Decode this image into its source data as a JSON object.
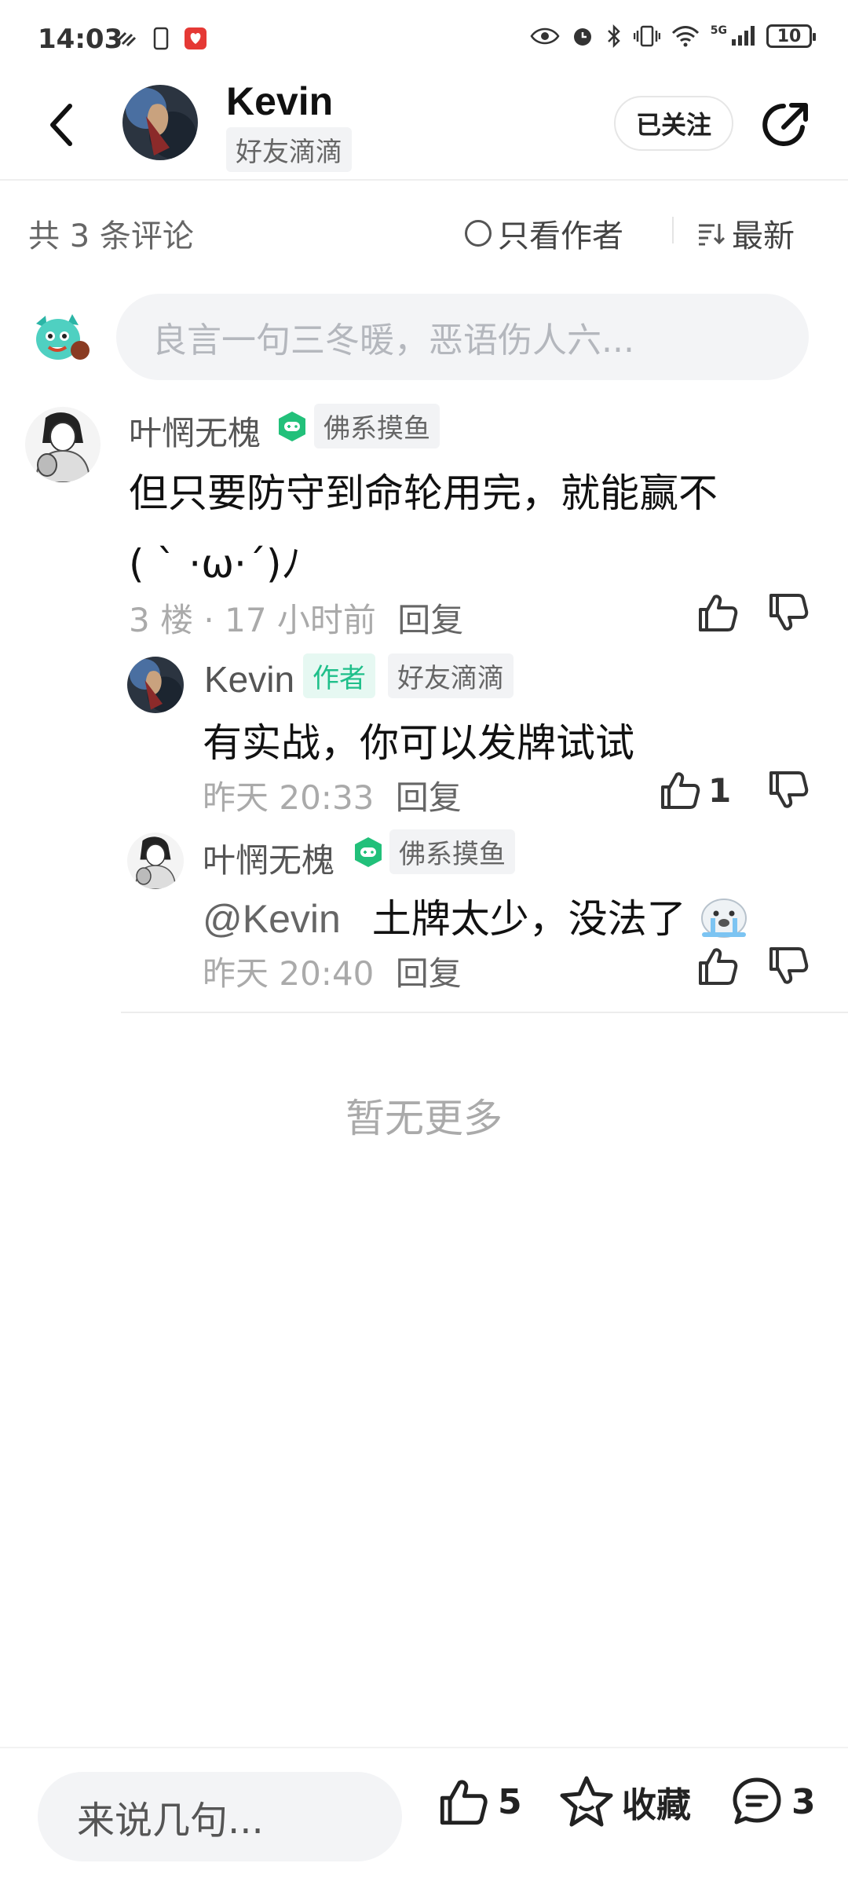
{
  "status_bar": {
    "time": "14:03",
    "battery": "10",
    "network": "5G"
  },
  "header": {
    "name": "Kevin",
    "badge": "好友滴滴",
    "follow_label": "已关注"
  },
  "comments_bar": {
    "count_label": "共 3 条评论",
    "author_only_label": "只看作者",
    "sort_label": "最新"
  },
  "input": {
    "placeholder": "良言一句三冬暖，恶语伤人六..."
  },
  "comments": [
    {
      "user": "叶惘无槐",
      "tag": "佛系摸鱼",
      "content_line1": "但只要防守到命轮用完，就能赢不",
      "content_line2": "( ` ·ω·´)ﾉ",
      "meta": "3 楼 · 17 小时前",
      "reply_label": "回复"
    }
  ],
  "replies": [
    {
      "user": "Kevin",
      "author_tag": "作者",
      "tag": "好友滴滴",
      "content": "有实战，你可以发牌试试",
      "time": "昨天 20:33",
      "reply_label": "回复",
      "likes": "1"
    },
    {
      "user": "叶惘无槐",
      "tag": "佛系摸鱼",
      "mention": "@Kevin",
      "content": "土牌太少，没法了",
      "time": "昨天 20:40",
      "reply_label": "回复"
    }
  ],
  "no_more": "暂无更多",
  "bottom": {
    "input_placeholder": "来说几句...",
    "like_count": "5",
    "favorite_label": "收藏",
    "comment_count": "3"
  },
  "colors": {
    "accent_green": "#1fbf8a",
    "tag_bg": "#f2f3f5"
  }
}
